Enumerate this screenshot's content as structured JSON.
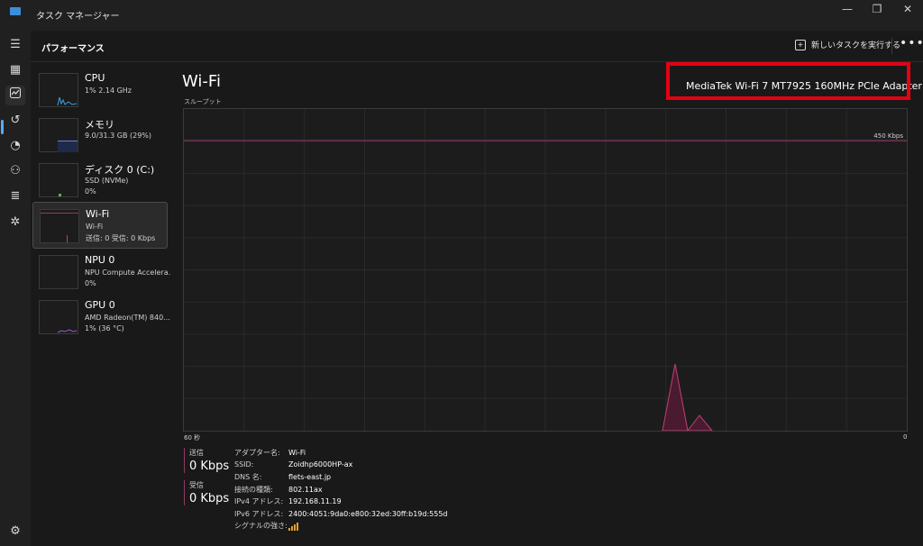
{
  "window": {
    "title": "タスク マネージャー",
    "minimize": "—",
    "restore": "❐",
    "close": "✕"
  },
  "rail": {
    "icons": [
      "hamburger-icon",
      "processes-icon",
      "performance-icon",
      "history-icon",
      "startup-icon",
      "users-icon",
      "details-icon",
      "services-icon",
      "settings-icon"
    ]
  },
  "header": {
    "title": "パフォーマンス",
    "new_task": "新しいタスクを実行する",
    "more": "•••"
  },
  "perf_items": [
    {
      "name": "CPU",
      "sub": "1%  2.14 GHz",
      "sub2": ""
    },
    {
      "name": "メモリ",
      "sub": "9.0/31.3 GB (29%)",
      "sub2": ""
    },
    {
      "name": "ディスク 0 (C:)",
      "sub": "SSD (NVMe)",
      "sub2": "0%"
    },
    {
      "name": "Wi-Fi",
      "sub": "Wi-Fi",
      "sub2": "送信: 0  受信: 0 Kbps"
    },
    {
      "name": "NPU 0",
      "sub": "NPU Compute Accelera.",
      "sub2": "0%"
    },
    {
      "name": "GPU 0",
      "sub": "AMD Radeon(TM) 840...",
      "sub2": "1%  (36 °C)"
    }
  ],
  "main": {
    "title": "Wi-Fi",
    "adapter": "MediaTek Wi-Fi 7 MT7925 160MHz PCIe Adapter",
    "throughput_label": "スループット",
    "scale": "450 Kbps",
    "axis_left": "60 秒",
    "axis_right": "0"
  },
  "colors": {
    "accent": "#8e3c64",
    "highlight": "#e60012",
    "cpu": "#3aa0e0",
    "mem": "#6a5acd",
    "disk": "#6aa84f"
  },
  "stats": {
    "send_label": "送信",
    "send_value": "0 Kbps",
    "recv_label": "受信",
    "recv_value": "0 Kbps"
  },
  "details": [
    {
      "key": "アダプター名:",
      "value": "Wi-Fi"
    },
    {
      "key": "SSID:",
      "value": "Zoidhp6000HP-ax"
    },
    {
      "key": "DNS 名:",
      "value": "flets-east.jp"
    },
    {
      "key": "接続の種類:",
      "value": "802.11ax"
    },
    {
      "key": "IPv4 アドレス:",
      "value": "192.168.11.19"
    },
    {
      "key": "IPv6 アドレス:",
      "value": "2400:4051:9da0:e800:32ed:30ff:b19d:555d"
    },
    {
      "key": "シグナルの強さ:",
      "value": ""
    }
  ]
}
